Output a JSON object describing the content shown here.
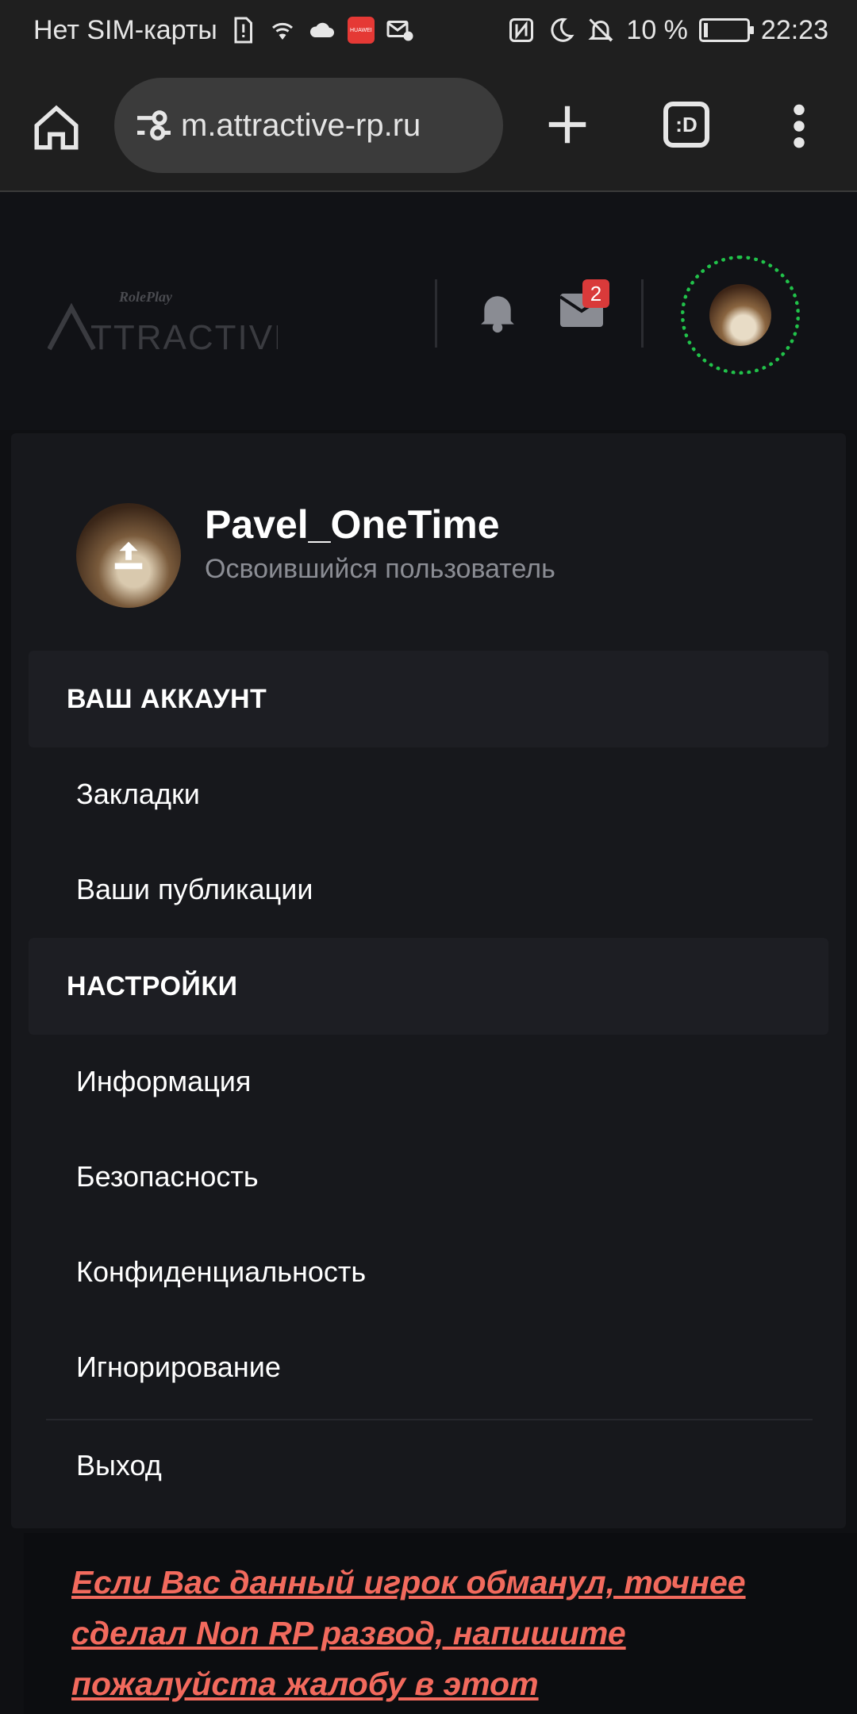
{
  "status_bar": {
    "carrier": "Нет SIM-карты",
    "huawei_label": "HUAWEI",
    "battery_percent": "10 %",
    "battery_level": 0.1,
    "time": "22:23",
    "icons": [
      "sim-alert-icon",
      "wifi-icon",
      "cloud-icon",
      "huawei-app-icon",
      "mail-settings-icon",
      "nfc-icon",
      "moon-icon",
      "bell-off-icon",
      "battery-charging-icon"
    ]
  },
  "browser": {
    "url": "m.attractive-rp.ru",
    "tabs_label": ":D"
  },
  "site_header": {
    "logo_text": "TTRACTIVE",
    "logo_subtext": "RolePlay",
    "mail_badge": "2"
  },
  "account": {
    "username": "Pavel_OneTime",
    "user_title": "Освоившийся пользователь",
    "section_account": "ВАШ АККАУНТ",
    "bookmarks": "Закладки",
    "your_posts": "Ваши публикации",
    "section_settings": "НАСТРОЙКИ",
    "info": "Информация",
    "security": "Безопасность",
    "privacy": "Конфиденциальность",
    "ignoring": "Игнорирование",
    "logout": "Выход"
  },
  "post": {
    "text": "Если Вас данный игрок обманул, точнее сделал Non RP развод, напишите пожалуйста жалобу в этот"
  },
  "colors": {
    "accent_green": "#21c24a",
    "badge_red": "#d93a3a",
    "post_link": "#f26a5d"
  }
}
